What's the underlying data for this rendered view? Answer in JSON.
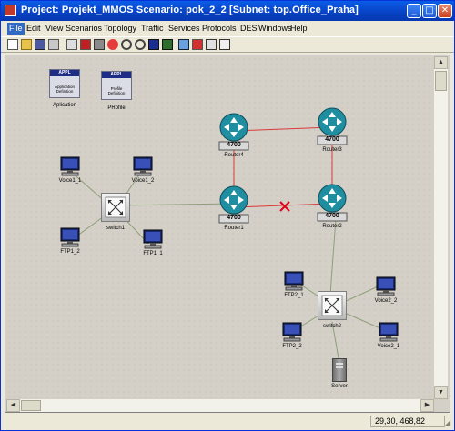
{
  "window": {
    "title": "Project: Projekt_MMOS Scenario: pok_2_2  [Subnet: top.Office_Praha]",
    "minimize": "_",
    "maximize": "□",
    "close": "✕"
  },
  "menu": [
    "File",
    "Edit",
    "View",
    "Scenarios",
    "Topology",
    "Traffic",
    "Services",
    "Protocols",
    "DES",
    "Windows",
    "Help"
  ],
  "toolbar_icons": [
    "new-icon",
    "open-icon",
    "save-icon",
    "print-icon",
    "scissors-icon",
    "object-palette-icon",
    "failure-icon",
    "zoom-in-icon",
    "zoom-out-icon",
    "configure-icon",
    "clock-icon",
    "capture-icon",
    "pin-icon",
    "view-results-icon",
    "hide-graphs-icon",
    "info-icon"
  ],
  "nodes": {
    "application_definition": {
      "header": "APPL",
      "text1": "Application",
      "text2": "Definition",
      "label": "Aplication"
    },
    "profile_definition": {
      "header": "APPL",
      "text1": "Profile",
      "text2": "Definition",
      "label": "PRofile"
    },
    "router_model": "4700",
    "router1": "Router1",
    "router2": "Router2",
    "router3": "Router3",
    "router4": "Router4",
    "switch1": "switch1",
    "switch2": "switch2",
    "voice1_1": "Voice1_1",
    "voice1_2": "Voice1_2",
    "ftp1_1": "FTP1_1",
    "ftp1_2": "FTP1_2",
    "ftp2_1": "FTP2_1",
    "ftp2_2": "FTP2_2",
    "voice2_1": "Voice2_1",
    "voice2_2": "Voice2_2",
    "server": "Server"
  },
  "link_colors": {
    "ethernet": "#8e9e78",
    "ppp": "#d83a3a",
    "failure_mark": "#e0001a"
  },
  "status": {
    "coords": "29,30, 468,82"
  }
}
